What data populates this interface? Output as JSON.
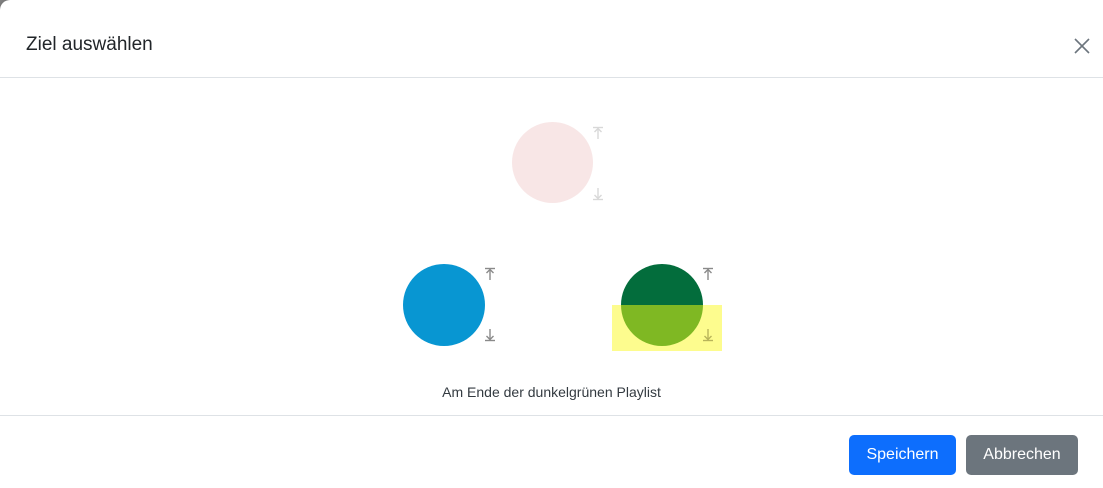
{
  "dialog": {
    "title": "Ziel auswählen",
    "caption": "Am Ende der dunkelgrünen Playlist"
  },
  "footer": {
    "save_label": "Speichern",
    "cancel_label": "Abbrechen"
  },
  "playlists": [
    {
      "name": "pink",
      "color": "#f8e6e6",
      "state": "disabled"
    },
    {
      "name": "blue",
      "color": "#0896d2",
      "state": "enabled"
    },
    {
      "name": "dark-green",
      "color": "#036d3c",
      "bottom_color": "#7fb823",
      "state": "selected-bottom"
    }
  ],
  "colors": {
    "primary": "#0d6efd",
    "secondary": "#6c757d",
    "highlight": "#fdfc8e",
    "arrow_gray": "#8a8a8a",
    "arrow_faint": "#d8d8d8"
  },
  "icons": [
    "close-icon",
    "insert-top-icon",
    "insert-bottom-icon"
  ]
}
